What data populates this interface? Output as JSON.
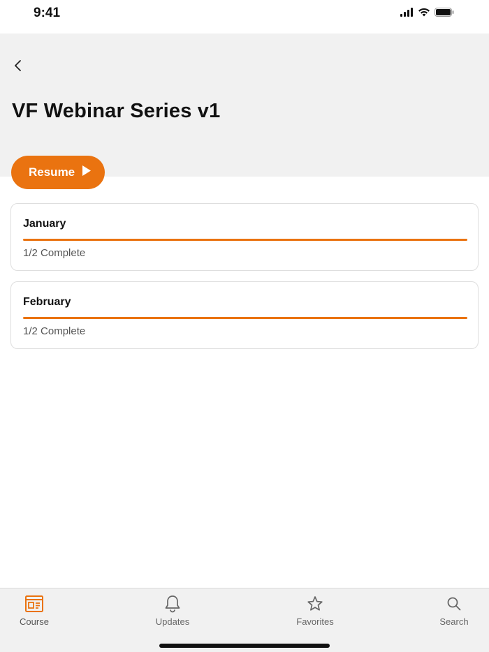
{
  "status_bar": {
    "time": "9:41"
  },
  "header": {
    "title": "VF Webinar Series v1",
    "resume_label": "Resume"
  },
  "sections": [
    {
      "title": "January",
      "status": "1/2 Complete",
      "progress": 1.0
    },
    {
      "title": "February",
      "status": "1/2 Complete",
      "progress": 1.0
    }
  ],
  "tabs": [
    {
      "label": "Course",
      "icon": "course-icon",
      "active": true
    },
    {
      "label": "Updates",
      "icon": "bell-icon",
      "active": false
    },
    {
      "label": "Favorites",
      "icon": "star-icon",
      "active": false
    },
    {
      "label": "Search",
      "icon": "search-icon",
      "active": false
    }
  ],
  "colors": {
    "accent": "#ea7310",
    "header_bg": "#f1f1f1",
    "text": "#111111",
    "muted": "#666666"
  }
}
